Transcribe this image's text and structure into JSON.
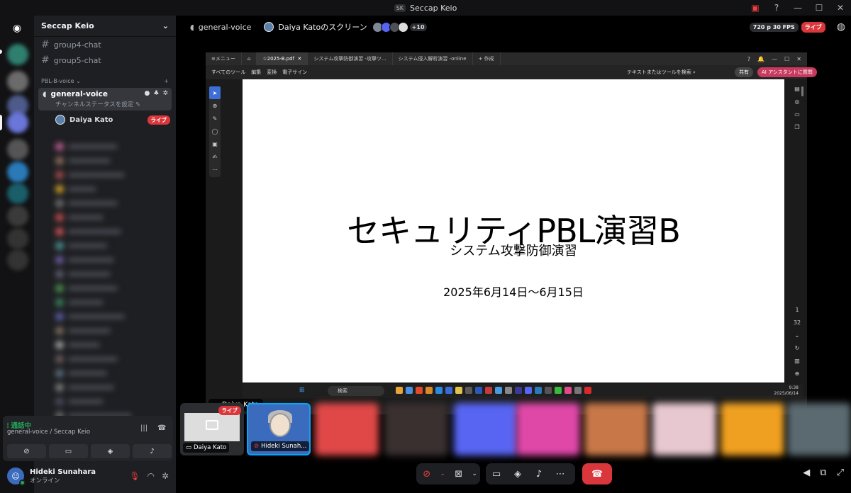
{
  "window": {
    "title": "Seccap Keio",
    "badge": "SK"
  },
  "server": {
    "name": "Seccap Keio"
  },
  "channels": [
    {
      "label": "group4-chat"
    },
    {
      "label": "group5-chat"
    }
  ],
  "category": {
    "label": "PBL-B-voice"
  },
  "voice_channel": {
    "name": "general-voice",
    "status": "チャンネルステータスを設定"
  },
  "voice_user": {
    "name": "Daiya Kato",
    "live": "ライブ"
  },
  "voice_panel": {
    "status": "通話中",
    "location": "general-voice / Seccap Keio"
  },
  "user": {
    "name": "Hideki Sunahara",
    "status": "オンライン"
  },
  "topbar": {
    "channel": "general-voice",
    "screen": "Daiya Katoのスクリーン",
    "more": "+10",
    "quality": "720 p 30 FPS",
    "live": "ライブ"
  },
  "pdf": {
    "tabs": [
      "メニュー",
      "2025-B.pdf",
      "システム攻撃防御演習 -攻撃ツ...",
      "システム侵入解析演習 -online",
      "+ 作成"
    ],
    "menu": [
      "すべてのツール",
      "編集",
      "変換",
      "電子サイン"
    ],
    "search": "テキストまたはツールを検索",
    "share": "共有",
    "ai": "AI アシスタントに質問",
    "page_num": "1",
    "page_total": "32"
  },
  "slide": {
    "title": "セキュリティPBL演習B",
    "subtitle": "システム攻撃防御演習",
    "date": "2025年6月14日〜6月15日"
  },
  "taskbar": {
    "search": "検索",
    "time": "9:38",
    "date": "2025/06/14"
  },
  "stream_label": "Daiya Kato",
  "tiles": [
    {
      "name": "Daiya Kato",
      "live": "ライブ"
    },
    {
      "name": "Hideki Sunah..."
    }
  ],
  "colors": {
    "accent": "#5865f2",
    "live": "#da373c",
    "online": "#23a55a",
    "danger": "#f23f43"
  }
}
